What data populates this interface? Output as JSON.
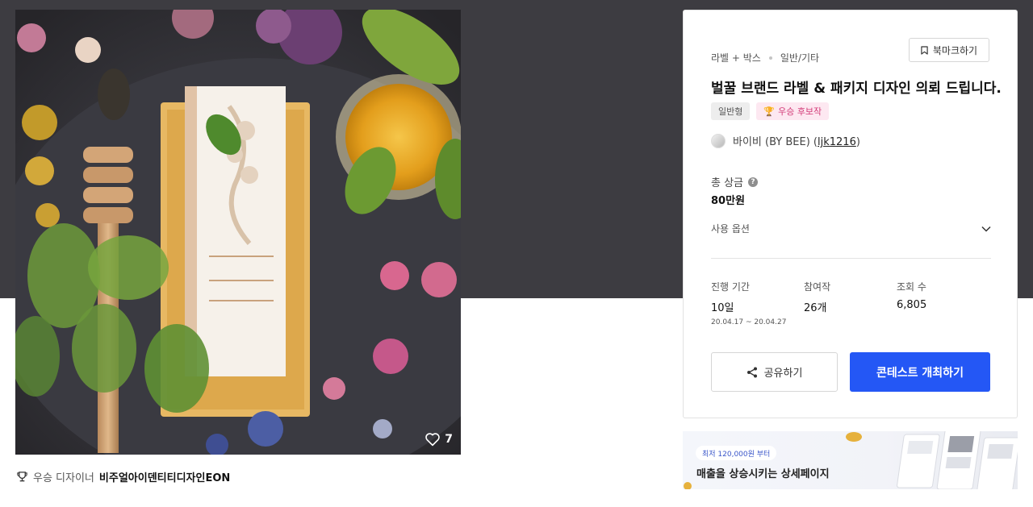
{
  "gallery": {
    "like_count": "7",
    "icons": {
      "like": "heart-outline-icon",
      "trophy": "trophy-icon"
    }
  },
  "designer": {
    "label": "우승 디자이너",
    "name": "비주얼아이덴티티디자인EON"
  },
  "contest": {
    "category_main": "라벨 + 박스",
    "category_sub": "일반/기타",
    "bookmark_label": "북마크하기",
    "title": "벌꿀 브랜드 라벨 & 패키지 디자인 의뢰 드립니다.",
    "badge_type": "일반형",
    "badge_winner": "우승 후보작",
    "holder_name": "바이비 (BY BEE) (",
    "holder_id": "ljk1216",
    "holder_close": ")",
    "prize_label": "총 상금",
    "prize_value": "80만원",
    "options_label": "사용 옵션",
    "stats": [
      {
        "label": "진행 기간",
        "value": "10일",
        "detail": "20.04.17  ~  20.04.27"
      },
      {
        "label": "참여작",
        "value": "26개",
        "detail": ""
      },
      {
        "label": "조회 수",
        "value": "6,805",
        "detail": ""
      }
    ],
    "share_label": "공유하기",
    "host_label": "콘테스트 개최하기"
  },
  "ad": {
    "chip": "최저 120,000원 부터",
    "text": "매출을 상승시키는 상세페이지"
  },
  "colors": {
    "primary": "#2457f5",
    "hero_band": "#3d3c41",
    "winner_badge": "#d23b78"
  }
}
